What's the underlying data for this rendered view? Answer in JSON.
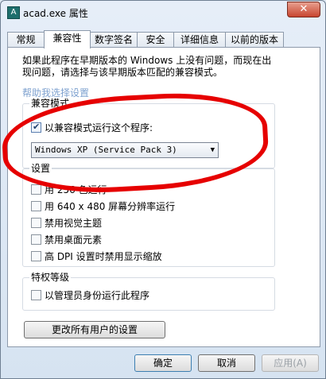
{
  "window": {
    "title": "acad.exe 属性",
    "app_icon": "app-icon",
    "close_glyph": "✕"
  },
  "tabs": [
    {
      "label": "常规",
      "active": false
    },
    {
      "label": "兼容性",
      "active": true
    },
    {
      "label": "数字签名",
      "active": false
    },
    {
      "label": "安全",
      "active": false
    },
    {
      "label": "详细信息",
      "active": false
    },
    {
      "label": "以前的版本",
      "active": false
    }
  ],
  "intro": {
    "line1": "如果此程序在早期版本的 Windows 上没有问题，而现在出",
    "line2": "现问题，请选择与该早期版本匹配的兼容模式。"
  },
  "help_choose_title": "帮助我选择设置",
  "compat_mode": {
    "title": "兼容模式",
    "checkbox_label": "以兼容模式运行这个程序:",
    "checked": true,
    "selected_os": "Windows XP (Service Pack 3)"
  },
  "settings": {
    "title": "设置",
    "options": [
      {
        "label": "用 256 色运行",
        "checked": false
      },
      {
        "label": "用 640 x 480 屏幕分辨率运行",
        "checked": false
      },
      {
        "label": "禁用视觉主题",
        "checked": false
      },
      {
        "label": "禁用桌面元素",
        "checked": false
      },
      {
        "label": "高 DPI 设置时禁用显示缩放",
        "checked": false
      }
    ]
  },
  "privilege": {
    "title": "特权等级",
    "checkbox_label": "以管理员身份运行此程序",
    "checked": false
  },
  "change_all_users_button": "更改所有用户的设置",
  "buttons": {
    "ok": "确定",
    "cancel": "取消",
    "apply": "应用(A)"
  },
  "colors": {
    "annotation": "#e60000"
  }
}
